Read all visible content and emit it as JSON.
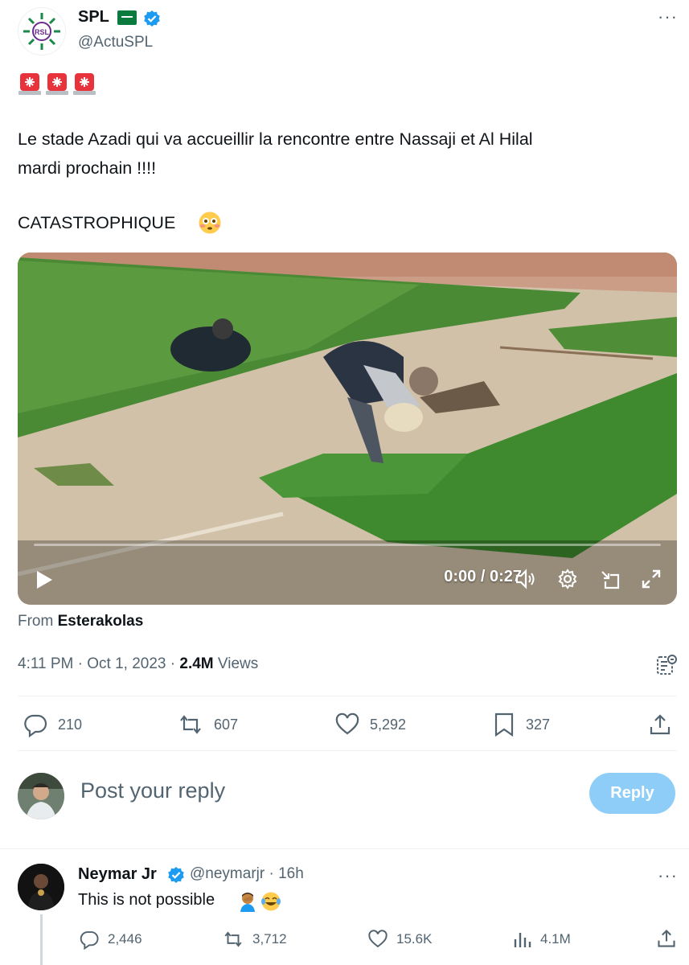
{
  "author": {
    "name": "SPL",
    "handle": "@ActuSPL",
    "avatar_text": "RSL",
    "flag": "saudi-arabia-flag",
    "verified": true
  },
  "tweet": {
    "emojis": [
      "police-light",
      "police-light",
      "police-light"
    ],
    "lines": [
      "Le stade Azadi qui va accueillir la rencontre entre Nassaji et Al Hilal",
      "mardi prochain !!!!",
      "CATASTROPHIQUE"
    ],
    "emoji_end": "flushed-face"
  },
  "video": {
    "time": "0:00 / 0:27",
    "from_label": "From",
    "from_account": "Esterakolas",
    "progress": 0
  },
  "meta": {
    "time": "4:11 PM",
    "date": "Oct 1, 2023",
    "views_count": "2.4M",
    "views_label": "Views"
  },
  "actions": {
    "replies": "210",
    "reposts": "607",
    "likes": "5,292",
    "bookmarks": "327"
  },
  "composer": {
    "placeholder": "Post your reply",
    "button": "Reply"
  },
  "comment": {
    "name": "Neymar Jr",
    "handle": "@neymarjr",
    "time": "16h",
    "text": "This is not possible",
    "emojis": [
      "man-facepalming",
      "face-with-tears-of-joy"
    ],
    "replies": "2,446",
    "reposts": "3,712",
    "likes": "15.6K",
    "views": "4.1M"
  },
  "colors": {
    "accent": "#1d9bf0",
    "reply_button": "#8ecdf7",
    "secondary_text": "#536471"
  }
}
